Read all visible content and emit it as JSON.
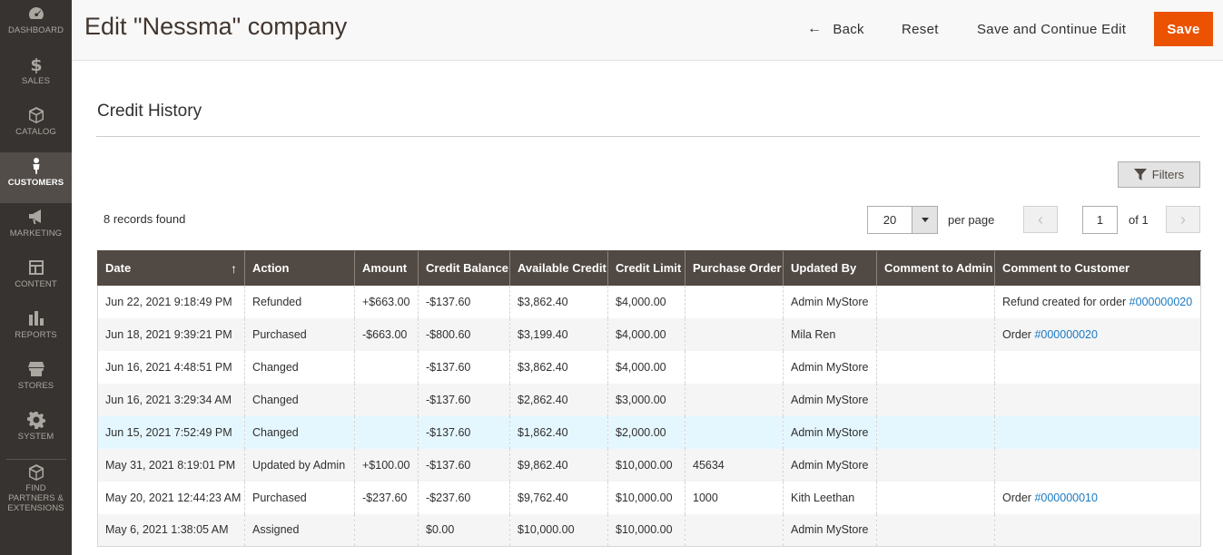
{
  "sidebar": {
    "items": [
      {
        "label": "DASHBOARD",
        "icon": "dashboard-icon"
      },
      {
        "label": "SALES",
        "icon": "dollar-icon"
      },
      {
        "label": "CATALOG",
        "icon": "cube-icon"
      },
      {
        "label": "CUSTOMERS",
        "icon": "person-icon",
        "active": true
      },
      {
        "label": "MARKETING",
        "icon": "megaphone-icon"
      },
      {
        "label": "CONTENT",
        "icon": "layout-icon"
      },
      {
        "label": "REPORTS",
        "icon": "bar-chart-icon"
      },
      {
        "label": "STORES",
        "icon": "store-icon"
      },
      {
        "label": "SYSTEM",
        "icon": "gear-icon"
      },
      {
        "label": "FIND PARTNERS & EXTENSIONS",
        "icon": "box-icon"
      }
    ]
  },
  "header": {
    "title": "Edit \"Nessma\" company",
    "back_label": "Back",
    "reset_label": "Reset",
    "save_continue_label": "Save and Continue Edit",
    "save_label": "Save"
  },
  "section": {
    "title": "Credit History"
  },
  "toolbar": {
    "filters_label": "Filters",
    "records_found": "8 records found",
    "per_page_value": "20",
    "per_page_label": "per page",
    "current_page": "1",
    "page_of": "of 1"
  },
  "table": {
    "columns": [
      "Date",
      "Action",
      "Amount",
      "Credit Balance",
      "Available Credit",
      "Credit Limit",
      "Purchase Order",
      "Updated By",
      "Comment to Admin",
      "Comment to Customer"
    ],
    "sort_indicator": "↑",
    "rows": [
      {
        "date": "Jun 22, 2021 9:18:49 PM",
        "action": "Refunded",
        "amount": "+$663.00",
        "balance": "-$137.60",
        "available": "$3,862.40",
        "limit": "$4,000.00",
        "po": "",
        "updated_by": "Admin MyStore",
        "comment_admin": "",
        "comment_customer": "Refund created for order ",
        "comment_link": "#000000020"
      },
      {
        "date": "Jun 18, 2021 9:39:21 PM",
        "action": "Purchased",
        "amount": "-$663.00",
        "balance": "-$800.60",
        "available": "$3,199.40",
        "limit": "$4,000.00",
        "po": "",
        "updated_by": "Mila Ren",
        "comment_admin": "",
        "comment_customer": "Order ",
        "comment_link": "#000000020"
      },
      {
        "date": "Jun 16, 2021 4:48:51 PM",
        "action": "Changed",
        "amount": "",
        "balance": "-$137.60",
        "available": "$3,862.40",
        "limit": "$4,000.00",
        "po": "",
        "updated_by": "Admin MyStore",
        "comment_admin": "",
        "comment_customer": "",
        "comment_link": ""
      },
      {
        "date": "Jun 16, 2021 3:29:34 AM",
        "action": "Changed",
        "amount": "",
        "balance": "-$137.60",
        "available": "$2,862.40",
        "limit": "$3,000.00",
        "po": "",
        "updated_by": "Admin MyStore",
        "comment_admin": "",
        "comment_customer": "",
        "comment_link": ""
      },
      {
        "date": "Jun 15, 2021 7:52:49 PM",
        "action": "Changed",
        "amount": "",
        "balance": "-$137.60",
        "available": "$1,862.40",
        "limit": "$2,000.00",
        "po": "",
        "updated_by": "Admin MyStore",
        "comment_admin": "",
        "comment_customer": "",
        "comment_link": ""
      },
      {
        "date": "May 31, 2021 8:19:01 PM",
        "action": "Updated by Admin",
        "amount": "+$100.00",
        "balance": "-$137.60",
        "available": "$9,862.40",
        "limit": "$10,000.00",
        "po": "45634",
        "updated_by": "Admin MyStore",
        "comment_admin": "",
        "comment_customer": "",
        "comment_link": ""
      },
      {
        "date": "May 20, 2021 12:44:23 AM",
        "action": "Purchased",
        "amount": "-$237.60",
        "balance": "-$237.60",
        "available": "$9,762.40",
        "limit": "$10,000.00",
        "po": "1000",
        "updated_by": "Kith Leethan",
        "comment_admin": "",
        "comment_customer": "Order ",
        "comment_link": "#000000010"
      },
      {
        "date": "May 6, 2021 1:38:05 AM",
        "action": "Assigned",
        "amount": "",
        "balance": "$0.00",
        "available": "$10,000.00",
        "limit": "$10,000.00",
        "po": "",
        "updated_by": "Admin MyStore",
        "comment_admin": "",
        "comment_customer": "",
        "comment_link": ""
      }
    ]
  },
  "colors": {
    "accent": "#eb5202",
    "sidebar_bg": "#373330",
    "table_header_bg": "#514943",
    "positive": "#49974a",
    "negative": "#d6454b",
    "link": "#1979c3",
    "highlight_row": "#e5f7fe"
  }
}
